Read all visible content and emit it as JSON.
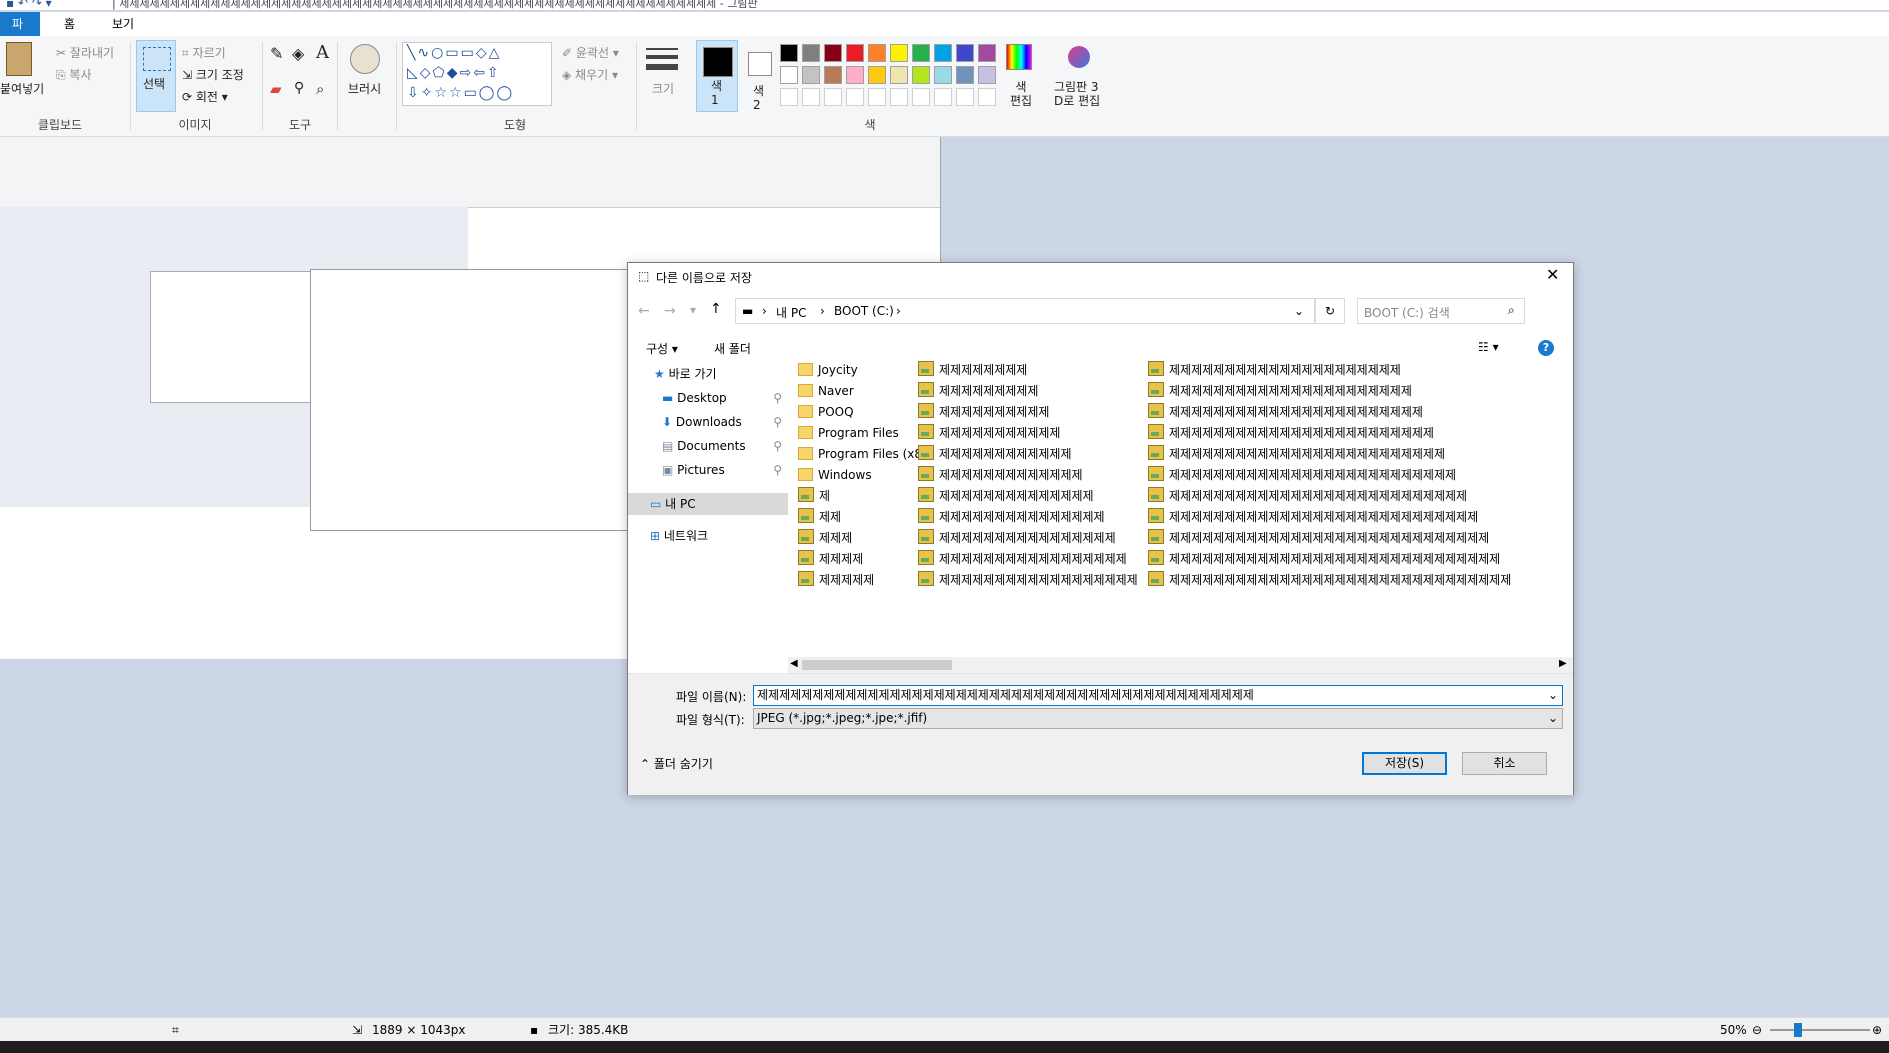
{
  "titlebar": {
    "title": "| 제제제제제제제제제제제제제제제제제제제제제제제제제제제제제제제제제제제제제제제제제제제제제제제제제제제제제제제제제제제 - 그림판"
  },
  "tabs": [
    "파일",
    "홈",
    "보기"
  ],
  "ribbon": {
    "clipboard": {
      "paste": "붙여넣기",
      "cut": "잘라내기",
      "copy": "복사",
      "label": "클립보드"
    },
    "image": {
      "select": "선택",
      "crop": "자르기",
      "resize": "크기 조정",
      "rotate": "회전",
      "label": "이미지"
    },
    "tools": {
      "label": "도구"
    },
    "brushes": {
      "label": "브러시"
    },
    "shapes": {
      "outline": "윤곽선",
      "fill": "채우기",
      "label": "도형"
    },
    "size": {
      "label": "크기"
    },
    "colors": {
      "color1": "색\n1",
      "color2": "색\n2",
      "edit": "색\n편집",
      "paint3d": "그림판 3\nD로 편집",
      "label": "색"
    },
    "palette": [
      "#000000",
      "#7f7f7f",
      "#880015",
      "#ed1c24",
      "#ff7f27",
      "#fff200",
      "#22b14c",
      "#00a2e8",
      "#3f48cc",
      "#a349a4",
      "#ffffff",
      "#c3c3c3",
      "#b97a57",
      "#ffaec9",
      "#ffc90e",
      "#efe4b0",
      "#b5e61d",
      "#99d9ea",
      "#7092be",
      "#c8bfe7"
    ]
  },
  "dialog": {
    "title": "다른 이름으로 저장",
    "breadcrumb": [
      "내 PC",
      "BOOT (C:)"
    ],
    "search_placeholder": "BOOT (C:) 검색",
    "organize": "구성",
    "new_folder": "새 폴더",
    "nav": {
      "quick_access": "바로 가기",
      "items": [
        "Desktop",
        "Downloads",
        "Documents",
        "Pictures"
      ],
      "this_pc": "내 PC",
      "network": "네트워크"
    },
    "files_col1": [
      {
        "name": "Joycity",
        "type": "folder"
      },
      {
        "name": "Naver",
        "type": "folder"
      },
      {
        "name": "POOQ",
        "type": "folder"
      },
      {
        "name": "Program Files",
        "type": "folder"
      },
      {
        "name": "Program Files (x86)",
        "type": "folder"
      },
      {
        "name": "Windows",
        "type": "folder"
      },
      {
        "name": "제",
        "type": "jpg"
      },
      {
        "name": "제제",
        "type": "jpg"
      },
      {
        "name": "제제제",
        "type": "jpg"
      },
      {
        "name": "제제제제",
        "type": "jpg"
      },
      {
        "name": "제제제제제",
        "type": "jpg"
      },
      {
        "name": "제제제제제제",
        "type": "jpg"
      },
      {
        "name": "제제제제제제제",
        "type": "jpg"
      }
    ],
    "files_col2": [
      "제제제제제제제제",
      "제제제제제제제제제",
      "제제제제제제제제제제",
      "제제제제제제제제제제제",
      "제제제제제제제제제제제제",
      "제제제제제제제제제제제제제",
      "제제제제제제제제제제제제제제",
      "제제제제제제제제제제제제제제제",
      "제제제제제제제제제제제제제제제제",
      "제제제제제제제제제제제제제제제제제",
      "제제제제제제제제제제제제제제제제제제",
      "제제제제제제제제제제제제제제제제제제제",
      "제제제제제제제제제제제제제제제제제제제제"
    ],
    "files_col3": [
      "제제제제제제제제제제제제제제제제제제제제제",
      "제제제제제제제제제제제제제제제제제제제제제제",
      "제제제제제제제제제제제제제제제제제제제제제제제",
      "제제제제제제제제제제제제제제제제제제제제제제제제",
      "제제제제제제제제제제제제제제제제제제제제제제제제제",
      "제제제제제제제제제제제제제제제제제제제제제제제제제제",
      "제제제제제제제제제제제제제제제제제제제제제제제제제제제",
      "제제제제제제제제제제제제제제제제제제제제제제제제제제제제",
      "제제제제제제제제제제제제제제제제제제제제제제제제제제제제제",
      "제제제제제제제제제제제제제제제제제제제제제제제제제제제제제제",
      "제제제제제제제제제제제제제제제제제제제제제제제제제제제제제제제",
      "제제제제제제제제제제제제제제제제제제제제제제제제제제제제제제제제",
      "제제제제제제제제제제제제제제제제제제제제제제제제제제제제제제제제제"
    ],
    "filename_label": "파일 이름(N):",
    "filename_value": "제제제제제제제제제제제제제제제제제제제제제제제제제제제제제제제제제제제제제제제제제제제제제",
    "filetype_label": "파일 형식(T):",
    "filetype_value": "JPEG (*.jpg;*.jpeg;*.jpe;*.jfif)",
    "hide_folders": "폴더 숨기기",
    "save": "저장(S)",
    "cancel": "취소"
  },
  "statusbar": {
    "dimensions": "1889 × 1043px",
    "size": "크기: 385.4KB",
    "zoom": "50%"
  }
}
